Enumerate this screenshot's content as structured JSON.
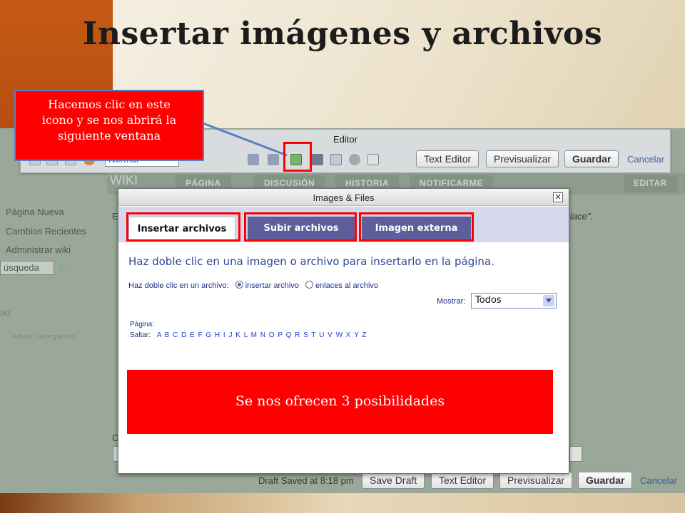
{
  "slide": {
    "title": "Insertar imágenes y archivos"
  },
  "callout": {
    "line1": "Hacemos clic en este",
    "line2": "icono y se nos abrirá la",
    "line3": "siguiente ventana"
  },
  "banner": {
    "text": "Se nos ofrecen 3 posibilidades"
  },
  "editor": {
    "title": "Editor",
    "format_value": "Normal",
    "text_editor_label": "Text Editor",
    "preview_label": "Previsualizar",
    "save_label": "Guardar",
    "cancel_label": "Cancelar"
  },
  "wiki": {
    "logo": "WIKI",
    "tabs": [
      "PÁGINA",
      "DISCUSIÓN",
      "HISTORIA",
      "NOTIFICARME"
    ],
    "edit_tab": "EDITAR",
    "sidebar": [
      "Página Nueva",
      "Cambios Recientes",
      "Administrar wiki"
    ],
    "search_value": "úsqueda",
    "side_wiki_label": "IKI",
    "side_note": "editar navegación",
    "partial_text_left": "E",
    "partial_text_right": "lace\".",
    "bottom_c": "C",
    "draft_saved": "Draft Saved at 8:18 pm",
    "save_draft_label": "Save Draft",
    "text_editor_label": "Text Editor",
    "preview_label": "Previsualizar",
    "save_label": "Guardar",
    "cancel_label": "Cancelar"
  },
  "dialog": {
    "title": "Images & Files",
    "close_glyph": "×",
    "tabs": [
      {
        "label": "Insertar archivos",
        "active": true
      },
      {
        "label": "Subir archivos",
        "active": false
      },
      {
        "label": "Imagen externa",
        "active": false
      }
    ],
    "instruction": "Haz doble clic en una imagen o archivo para insertarlo en la página.",
    "radio_prompt": "Haz doble clic en un archivo:",
    "radio_options": [
      {
        "label": "insertar archivo",
        "checked": true
      },
      {
        "label": "enlaces al archivo",
        "checked": false
      }
    ],
    "show_label": "Mostrar:",
    "show_value": "Todos",
    "page_label": "Página:",
    "jump_label": "Saltar:",
    "jump_letters": "A B C D E F G H I J K L M N O P Q R S T U V W X Y Z"
  },
  "colors": {
    "highlight": "#ff0000",
    "tab_inactive": "#5d5f9c",
    "link_blue": "#1e3bd0"
  }
}
